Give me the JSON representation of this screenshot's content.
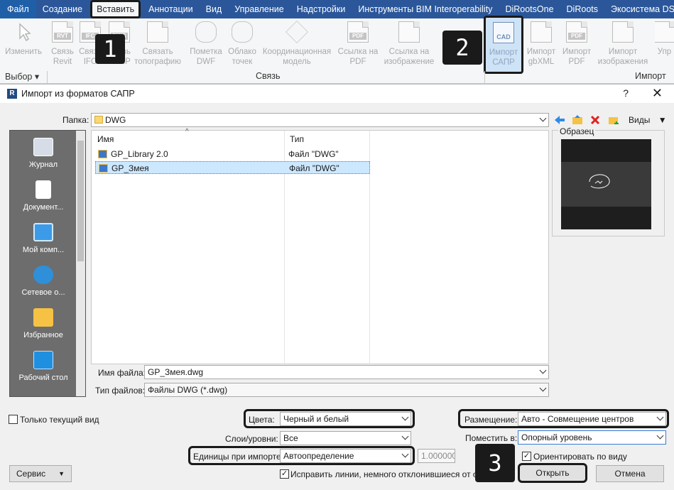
{
  "ribbon_tabs": [
    "Файл",
    "Создание",
    "Вставить",
    "Аннотации",
    "Вид",
    "Управление",
    "Надстройки",
    "Инструменты BIM Interoperability",
    "DiRootsOne",
    "DiRoots",
    "Экосистема DS"
  ],
  "ribbon_buttons": {
    "modify": "Изменить",
    "link_revit": "Связь Revit",
    "link_ifc": "Связь IFC",
    "link_cad": "Связь САПР",
    "link_photo": "Связать топографию",
    "dwf_markup": "Пометка DWF",
    "point_cloud": "Облако точек",
    "coord_model": "Координационная модель",
    "pdf_link": "Ссылка на PDF",
    "image_link": "Ссылка на изображение",
    "import_cad": "Импорт САПР",
    "import_gbxml": "Импорт gbXML",
    "import_pdf": "Импорт PDF",
    "import_image": "Импорт изображения",
    "more": "Упр"
  },
  "ribbon_groups": {
    "select": "Выбор",
    "link": "Связь",
    "import": "Импорт"
  },
  "badges": [
    "1",
    "2",
    "3"
  ],
  "dialog": {
    "title": "Импорт из форматов САПР",
    "help": "?",
    "close": "✕",
    "folder_label": "Папка:",
    "folder_value": "DWG",
    "views_label": "Виды",
    "preview_label": "Образец",
    "places": [
      "Журнал",
      "Документ...",
      "Мой комп...",
      "Сетевое о...",
      "Избранное",
      "Рабочий стол"
    ],
    "columns": {
      "name": "Имя",
      "type": "Тип"
    },
    "files": [
      {
        "name": "GP_Library 2.0",
        "type": "Файл \"DWG\""
      },
      {
        "name": "GP_Змея",
        "type": "Файл \"DWG\""
      }
    ],
    "filename_label": "Имя файла:",
    "filename_value": "GP_Змея.dwg",
    "filetype_label": "Тип файлов:",
    "filetype_value": "Файлы DWG  (*.dwg)",
    "current_view_only": "Только текущий вид",
    "colors_label": "Цвета:",
    "colors_value": "Черный и белый",
    "layers_label": "Слои/уровни:",
    "layers_value": "Все",
    "units_label": "Единицы при импорте:",
    "units_value": "Автоопределение",
    "units_factor": "1.000000",
    "fix_lines": "Исправить линии, немного отклонившиеся от оси",
    "placement_label": "Размещение:",
    "placement_value": "Авто - Совмещение центров",
    "place_at_label": "Поместить в:",
    "place_at_value": "Опорный уровень",
    "orient_to_view": "Ориентировать по виду",
    "tools_button": "Сервис",
    "open_button": "Открыть",
    "cancel_button": "Отмена"
  }
}
